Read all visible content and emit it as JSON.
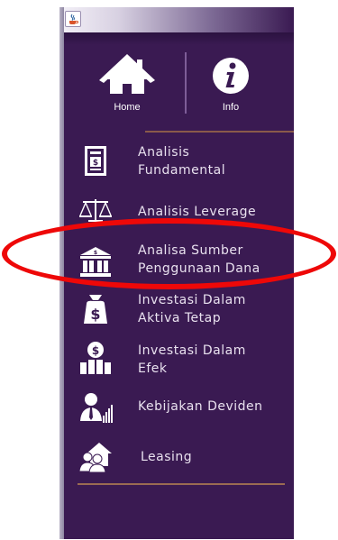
{
  "nav": {
    "home_label": "Home",
    "info_label": "Info"
  },
  "menu": {
    "items": [
      {
        "label": "Analisis Fundamental",
        "icon": "document-dollar-icon"
      },
      {
        "label": "Analisis Leverage",
        "icon": "balance-scale-icon"
      },
      {
        "label": "Analisa Sumber Penggunaan Dana",
        "icon": "bank-icon"
      },
      {
        "label": "Investasi Dalam Aktiva Tetap",
        "icon": "money-bag-icon"
      },
      {
        "label": "Investasi Dalam Efek",
        "icon": "coin-buildings-icon"
      },
      {
        "label": "Kebijakan Deviden",
        "icon": "businessman-chart-icon"
      },
      {
        "label": "Leasing",
        "icon": "people-house-icon"
      }
    ]
  },
  "colors": {
    "background": "#3a1a52",
    "text": "#e9e1ef",
    "accent_line": "#8a5a4a",
    "annotation": "#ee0808"
  }
}
